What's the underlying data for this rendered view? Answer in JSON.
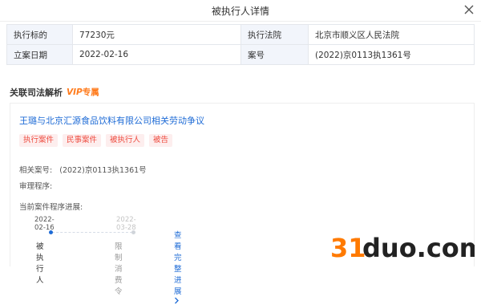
{
  "dialog": {
    "title": "被执行人详情"
  },
  "info": [
    {
      "label": "执行标的",
      "value": "77230元",
      "label2": "执行法院",
      "value2": "北京市顺义区人民法院"
    },
    {
      "label": "立案日期",
      "value": "2022-02-16",
      "label2": "案号",
      "value2": "(2022)京0113执1361号"
    }
  ],
  "section": {
    "title": "关联司法解析",
    "vip_italic": "VIP",
    "vip_suffix": "专属"
  },
  "case": {
    "title": "王璐与北京汇源食品饮料有限公司相关劳动争议",
    "tags": [
      "执行案件",
      "民事案件",
      "被执行人",
      "被告"
    ],
    "related_label": "相关案号:",
    "related_value": "(2022)京0113执1361号",
    "procedure_label": "审理程序:",
    "progress_label": "当前案件程序进展:",
    "steps": [
      {
        "date": "2022-02-16",
        "label": "被执行人",
        "active": true
      },
      {
        "date": "2022-03-28",
        "label": "限制消费令",
        "active": false
      }
    ],
    "more_link": "查看完整进展"
  },
  "watermark": {
    "text": "31duo.com"
  },
  "colors": {
    "accent": "#1e6bd6",
    "tag_text": "#ee4b3f",
    "tag_bg": "#fdeeee",
    "vip": "#ff7b1c",
    "watermark": "#ff7a00"
  },
  "icons": {
    "close": "close-icon",
    "chevron": "chevron-right-icon"
  }
}
